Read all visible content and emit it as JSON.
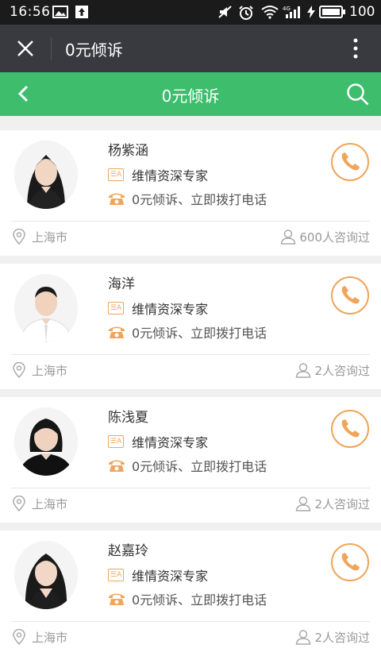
{
  "status_bar": {
    "time": "16:56",
    "battery": "100"
  },
  "wx_bar": {
    "title": "0元倾诉"
  },
  "green_bar": {
    "title": "0元倾诉"
  },
  "experts": [
    {
      "name": "杨紫涵",
      "tag": "维情资深专家",
      "phone_text": "0元倾诉、立即拨打电话",
      "location": "上海市",
      "consult_count": "600人咨询过"
    },
    {
      "name": "海洋",
      "tag": "维情资深专家",
      "phone_text": "0元倾诉、立即拨打电话",
      "location": "上海市",
      "consult_count": "2人咨询过"
    },
    {
      "name": "陈浅夏",
      "tag": "维情资深专家",
      "phone_text": "0元倾诉、立即拨打电话",
      "location": "上海市",
      "consult_count": "2人咨询过"
    },
    {
      "name": "赵嘉玲",
      "tag": "维情资深专家",
      "phone_text": "0元倾诉、立即拨打电话",
      "location": "上海市",
      "consult_count": "2人咨询过"
    }
  ],
  "colors": {
    "accent_green": "#3ebd6d",
    "accent_orange": "#f0a55a",
    "titlebar": "#393a3f"
  }
}
